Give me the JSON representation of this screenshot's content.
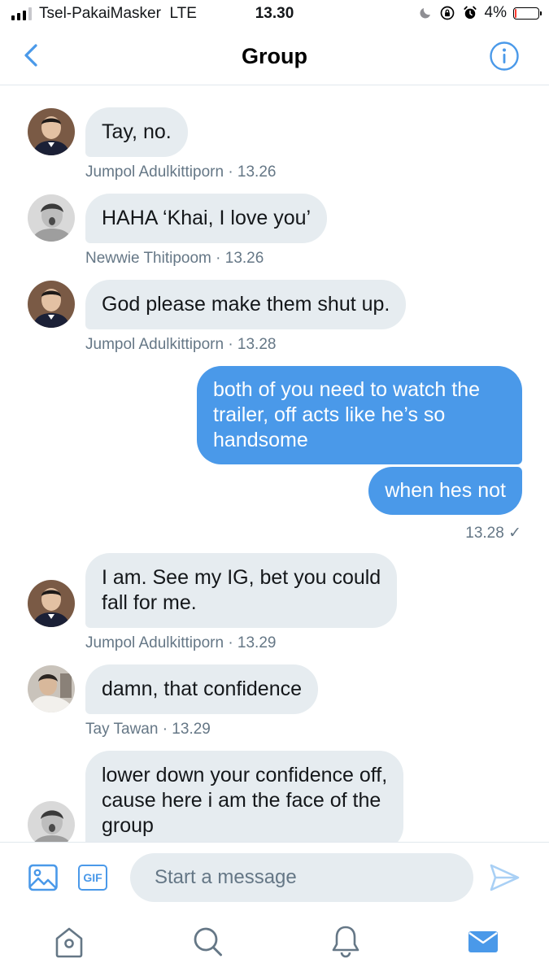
{
  "status_bar": {
    "carrier": "Tsel-PakaiMasker",
    "network": "LTE",
    "time": "13.30",
    "battery_percent": "4%",
    "battery_level": 0.04,
    "signal_bars": 3,
    "icons": [
      "moon-icon",
      "rotation-lock-icon",
      "alarm-icon"
    ]
  },
  "header": {
    "title": "Group",
    "back_icon": "chevron-left-icon",
    "info_icon": "info-icon"
  },
  "colors": {
    "accent": "#4a99e9",
    "incoming_bubble": "#e6ecf0",
    "meta_text": "#657786"
  },
  "messages": [
    {
      "direction": "in",
      "text": "Tay, no.",
      "meta": "Jumpol Adulkittiporn · 13.26",
      "avatar": "avatar-jumpol"
    },
    {
      "direction": "in",
      "text": "HAHA ‘Khai, I love you’",
      "meta": "Newwie Thitipoom · 13.26",
      "avatar": "avatar-newwie"
    },
    {
      "direction": "in",
      "text": "God please make them shut up.",
      "meta": "Jumpol Adulkittiporn · 13.28",
      "avatar": "avatar-jumpol"
    },
    {
      "direction": "out",
      "text": "both of you need to watch the\ntrailer, off acts like he’s so\nhandsome"
    },
    {
      "direction": "out",
      "text": "when hes not",
      "meta": "13.28 ✓"
    },
    {
      "direction": "in",
      "text": "I am. See my IG, bet you could\nfall for me.",
      "meta": "Jumpol Adulkittiporn · 13.29",
      "avatar": "avatar-jumpol"
    },
    {
      "direction": "in",
      "text": "damn, that confidence",
      "meta": "Tay Tawan · 13.29",
      "avatar": "avatar-tay"
    },
    {
      "direction": "in",
      "text": "lower down your confidence off,\ncause here i am the face of the\ngroup",
      "avatar": "avatar-newwie"
    }
  ],
  "composer": {
    "placeholder": "Start a message",
    "gif_label": "GIF",
    "media_icon": "image-icon",
    "send_icon": "send-icon"
  },
  "tab_bar": {
    "icons": [
      "home-icon",
      "search-icon",
      "bell-icon",
      "mail-icon"
    ],
    "active": "mail-icon"
  }
}
